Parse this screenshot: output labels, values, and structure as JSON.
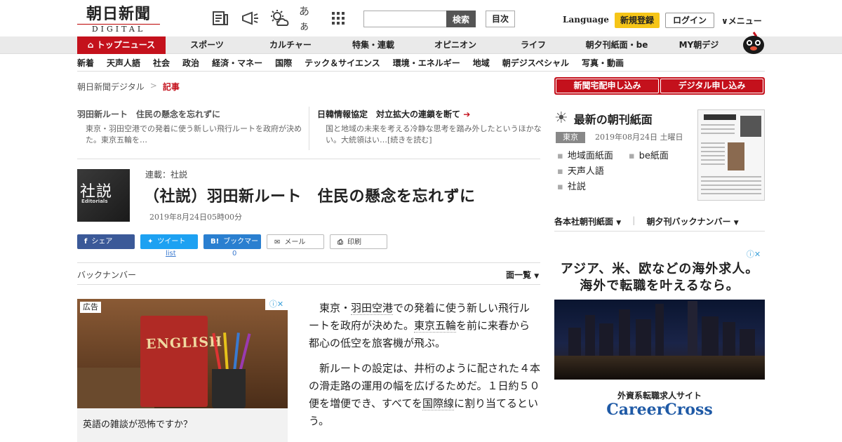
{
  "header": {
    "logo_line1": "朝日新聞",
    "logo_line2": "DIGITAL",
    "icons": [
      "newspaper-icon",
      "megaphone-icon",
      "weather-icon",
      "font-size-icon",
      "grid-menu-icon"
    ],
    "font_icon_text": "あぁ",
    "search_placeholder": "",
    "search_button": "検索",
    "index_button": "目次",
    "language": "Language",
    "register": "新規登録",
    "login": "ログイン",
    "menu": "メニュー"
  },
  "main_nav": [
    {
      "label": "トップニュース",
      "active": true
    },
    {
      "label": "スポーツ"
    },
    {
      "label": "カルチャー"
    },
    {
      "label": "特集・連載"
    },
    {
      "label": "オピニオン"
    },
    {
      "label": "ライフ"
    },
    {
      "label": "朝夕刊紙面・be"
    },
    {
      "label": "MY朝デジ"
    }
  ],
  "sub_nav": [
    "新着",
    "天声人語",
    "社会",
    "政治",
    "経済・マネー",
    "国際",
    "テック＆サイエンス",
    "環境・エネルギー",
    "地域",
    "朝デジスペシャル",
    "写真・動画"
  ],
  "breadcrumb": {
    "home": "朝日新聞デジタル",
    "sep": ">",
    "current": "記事"
  },
  "related": [
    {
      "title": "羽田新ルート　住民の懸念を忘れずに",
      "summary": "東京・羽田空港での発着に使う新しい飛行ルートを政府が決めた。東京五輪を…"
    },
    {
      "title": "日韓情報協定　対立拡大の連鎖を断て",
      "summary": "国と地域の未来を考える冷静な思考を踏み外したというほかない。大統領はい…[続きを読む]"
    }
  ],
  "article": {
    "thumb_kanji": "社説",
    "thumb_en": "Editorials",
    "series": "連載：社説",
    "title": "（社説）羽田新ルート　住民の懸念を忘れずに",
    "date": "2019年8月24日05時00分",
    "share": {
      "facebook": "シェア",
      "twitter": "ツイート",
      "hatena": "ブックマーク",
      "mail": "メール",
      "print": "印刷",
      "twitter_count": "list",
      "hatena_count": "0"
    },
    "back_number": "バックナンバー",
    "page_list": "面一覧",
    "body": [
      {
        "pre": "東京・",
        "kw1": "羽田空港",
        "mid": "での発着に使う新しい飛行ルートを政府が決めた。",
        "kw2": "東京五輪",
        "post": "を前に来春から都心の低空を旅客機が飛ぶ。"
      },
      {
        "pre": "新ルートの設定は、井桁のように配された４本の滑走路の運用の幅を広げるためだ。１日約５０便を増便でき、すべてを",
        "kw1": "国際線",
        "mid": "に割り当てるという。",
        "kw2": "",
        "post": ""
      }
    ]
  },
  "ad_left": {
    "tag": "広告",
    "book_title": "ENGLISH",
    "caption": "英語の雑談が恐怖ですか？"
  },
  "right": {
    "subscribe_paper": "新聞宅配申し込み",
    "subscribe_digital": "デジタル申し込み",
    "morning_title": "最新の朝刊紙面",
    "region": "東京",
    "paper_date": "2019年08月24日 土曜日",
    "paper_links": [
      [
        "地域面紙面",
        "be紙面"
      ],
      [
        "天声人語"
      ],
      [
        "社説"
      ]
    ],
    "links": [
      "各本社朝刊紙面",
      "朝夕刊バックナンバー"
    ]
  },
  "ad_right": {
    "headline1": "アジア、米、欧などの海外求人。",
    "headline2": "海外で転職を叶えるなら。",
    "sub": "外資系転職求人サイト",
    "brand": "CareerCross"
  },
  "colors": {
    "brand_red": "#c4111c",
    "register_yellow": "#f5c518",
    "link_blue": "#3b7ad0"
  }
}
